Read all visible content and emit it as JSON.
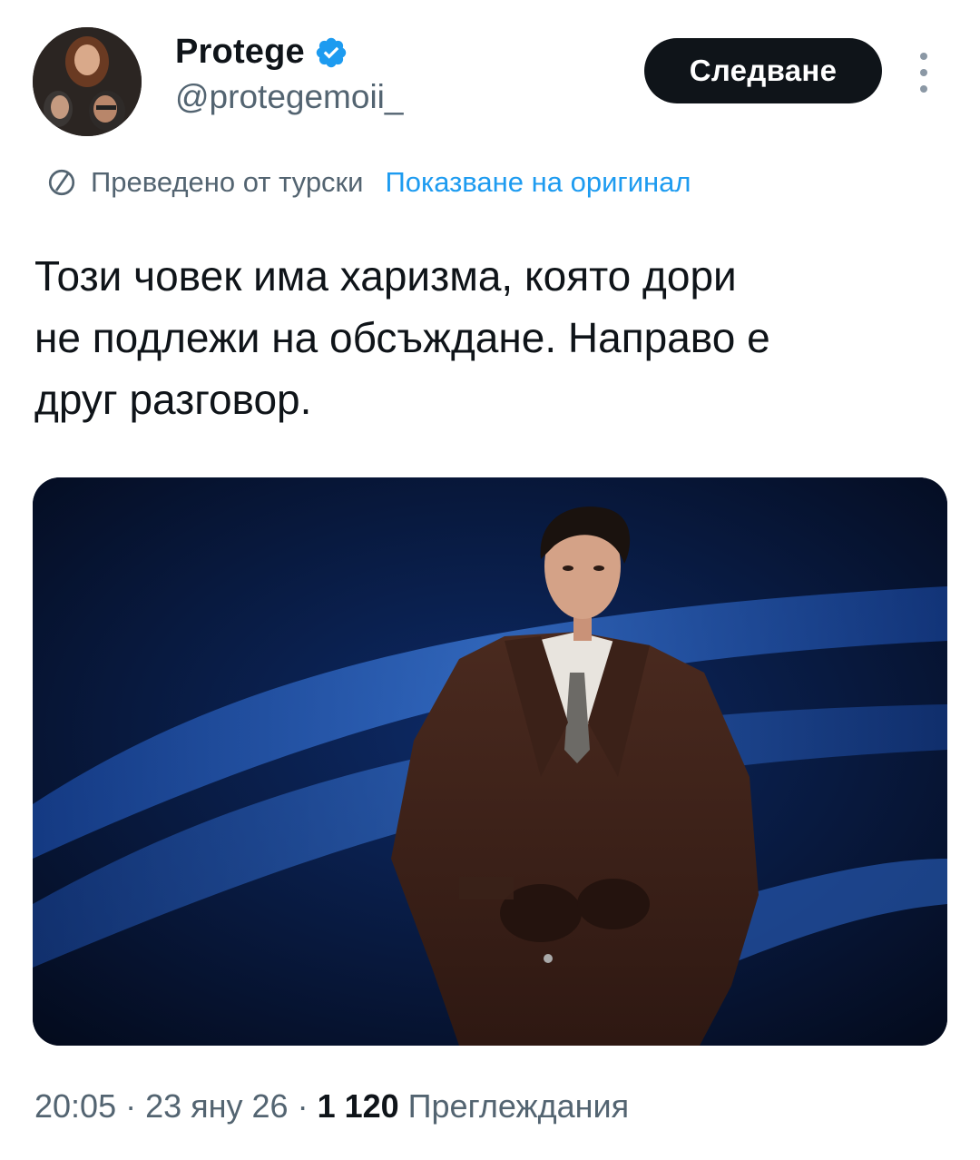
{
  "author": {
    "display_name": "Protege",
    "handle": "@protegemoii_",
    "verified": true
  },
  "follow_button": {
    "label": "Следване"
  },
  "more_icon": "ellipsis-vertical-icon",
  "translation": {
    "icon": "globe-icon",
    "translated_from": "Преведено от турски",
    "show_original": "Показване на оригинал"
  },
  "tweet": {
    "lines": [
      "Този човек има харизма, която дори",
      "не подлежи на обсъждане. Направо е",
      "друг разговор."
    ]
  },
  "meta": {
    "time": "20:05",
    "date": "23 яну 26",
    "views_count": "1 120",
    "views_label": "Преглеждания"
  },
  "colors": {
    "text": "#0f1419",
    "secondary": "#536471",
    "link": "#1d9bf0",
    "verified": "#1d9bf0"
  }
}
